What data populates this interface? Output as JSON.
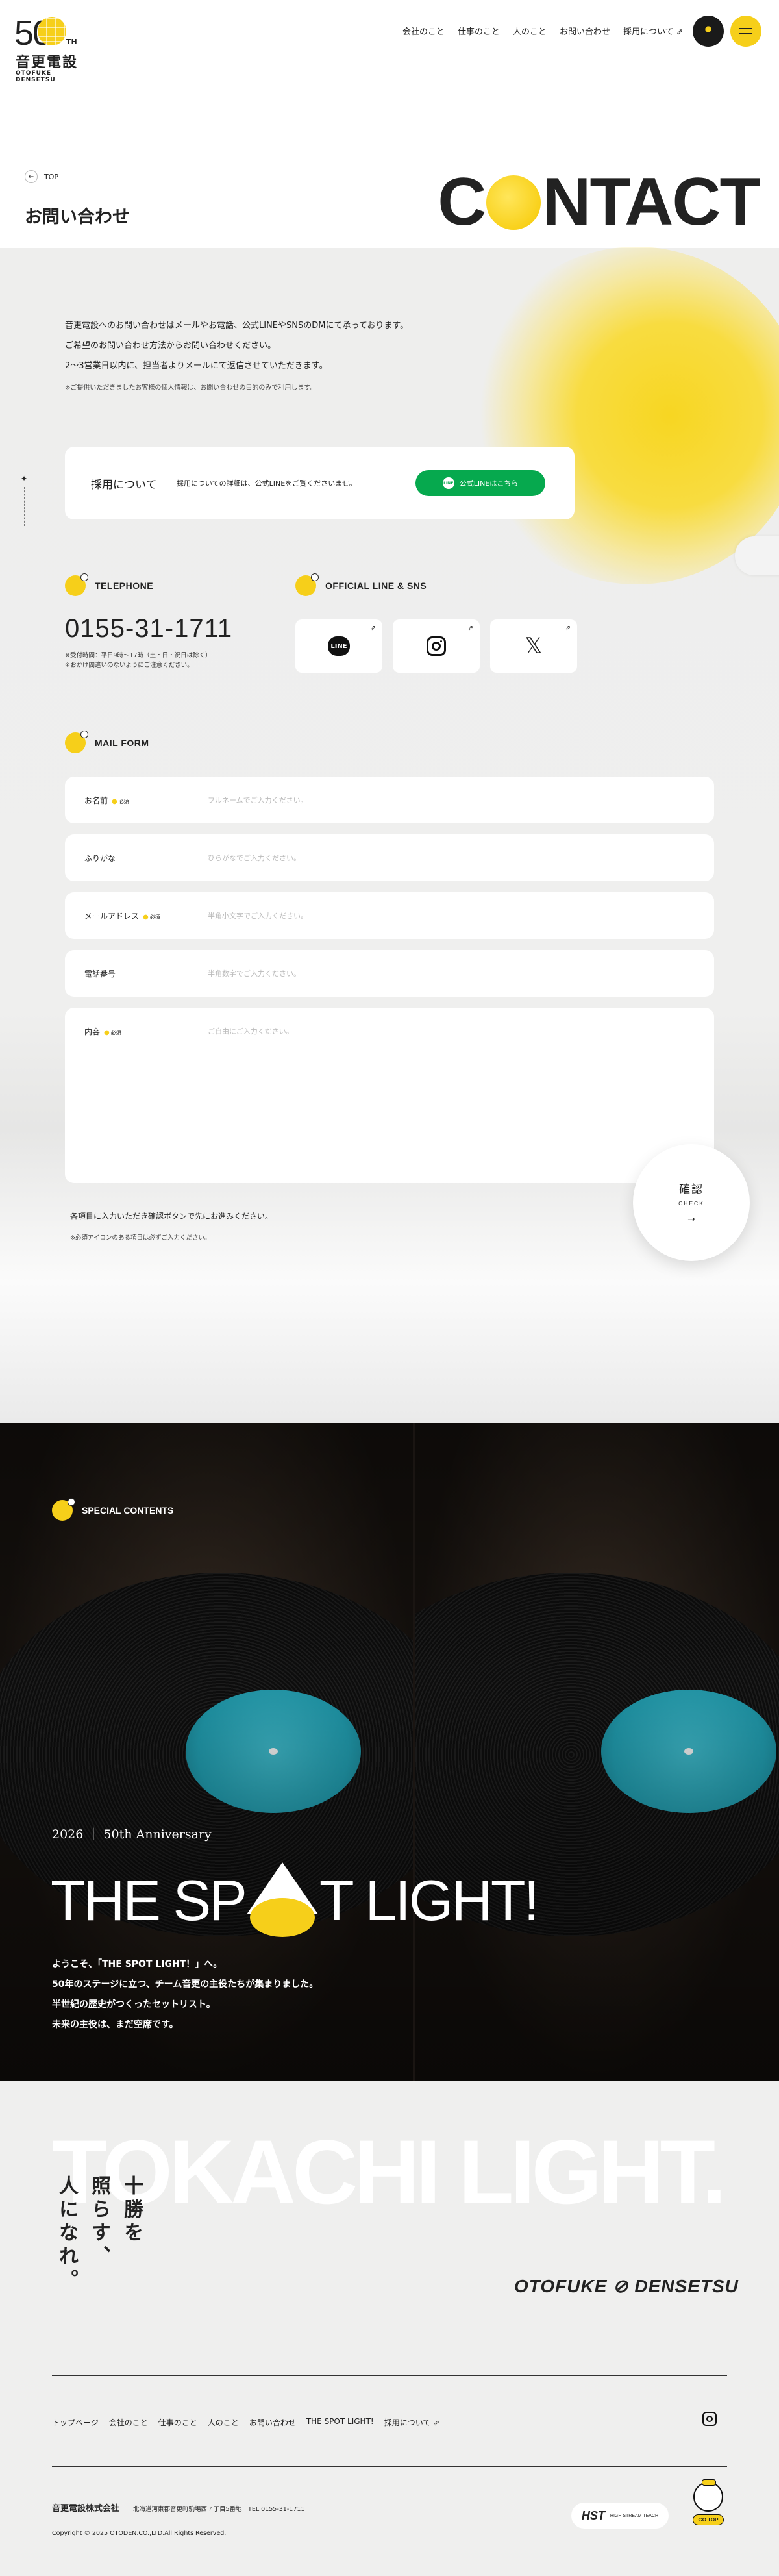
{
  "header": {
    "logo_50": "50",
    "logo_th": "TH",
    "logo_ja": "音更電設",
    "logo_en": "OTOFUKE DENSETSU",
    "nav": [
      "会社のこと",
      "仕事のこと",
      "人のこと",
      "お問い合わせ",
      "採用について ⇗"
    ]
  },
  "hero": {
    "crumb": "TOP",
    "title": "お問い合わせ",
    "big_c": "C",
    "big_rest": "NTACT"
  },
  "intro": {
    "lines": [
      "音更電設へのお問い合わせはメールやお電話、公式LINEやSNSのDMにて承っております。",
      "ご希望のお問い合わせ方法からお問い合わせください。",
      "2～3営業日以内に、担当者よりメールにて返信させていただきます。"
    ],
    "note": "※ご提供いただきましたお客様の個人情報は、お問い合わせの目的のみで利用します。"
  },
  "recruit": {
    "title": "採用について",
    "text": "採用についての詳細は、公式LINEをご覧くださいませ。",
    "button": "公式LINEはこちら",
    "button_icon": "LINE"
  },
  "telephone": {
    "head": "TELEPHONE",
    "number": "0155-31-1711",
    "note1": "※受付時間：平日9時～17時（土・日・祝日は除く）",
    "note2": "※おかけ間違いのないようにご注意ください。"
  },
  "sns": {
    "head": "OFFICIAL LINE & SNS",
    "line_label": "LINE",
    "x_label": "𝕏",
    "ext": "⇗"
  },
  "form": {
    "head": "MAIL FORM",
    "required": "必須",
    "fields": [
      {
        "label": "お名前",
        "placeholder": "フルネームでご入力ください。"
      },
      {
        "label": "ふりがな",
        "placeholder": "ひらがなでご入力ください。"
      },
      {
        "label": "メールアドレス",
        "placeholder": "半角小文字でご入力ください。"
      },
      {
        "label": "電話番号",
        "placeholder": "半角数字でご入力ください。"
      },
      {
        "label": "内容",
        "placeholder": "ご自由にご入力ください。"
      }
    ],
    "note1": "各項目に入力いただき確認ボタンで先にお進みください。",
    "note2": "※必須アイコンのある項目は必ずご入力ください。",
    "confirm_ja": "確認",
    "confirm_en": "CHECK",
    "confirm_arrow": "→"
  },
  "spotlight": {
    "head": "SPECIAL CONTENTS",
    "year": "2026 ｜ 50th Anniversary",
    "title_a": "THE SP",
    "title_b": "T LIGHT!",
    "body": [
      "ようこそ、「THE SPOT LIGHT！」へ。",
      "50年のステージに立つ、チーム音更の主役たちが集まりました。",
      "半世紀の歴史がつくったセットリスト。",
      "未来の主役は、まだ空席です。"
    ]
  },
  "footer": {
    "big": "TOKACHI LIGHT.",
    "vertical": [
      "十勝を",
      "照らす、",
      "人になれ。"
    ],
    "brand": "OTOFUKE ⊘ DENSETSU",
    "nav": [
      "トップページ",
      "会社のこと",
      "仕事のこと",
      "人のこと",
      "お問い合わせ",
      "THE SPOT LIGHT!",
      "採用について ⇗"
    ],
    "company": "音更電設株式会社",
    "address": "北海道河東郡音更町駒場西７丁目5番地　TEL 0155-31-1711",
    "copyright": "Copyright © 2025 OTODEN.CO.,LTD.All Rights Reserved.",
    "hst": "HST",
    "hst_small": "HIGH STREAM TEACH",
    "gotop": "GO TOP"
  }
}
